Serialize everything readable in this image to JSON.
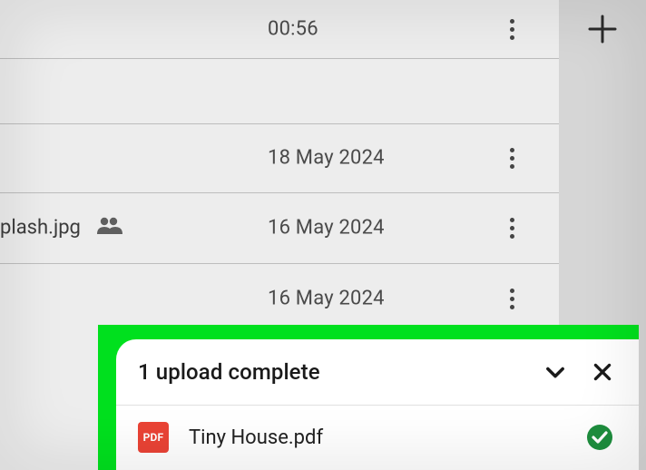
{
  "list": {
    "rows": [
      {
        "date": "00:56"
      },
      {
        "date": ""
      },
      {
        "date": "18 May 2024"
      },
      {
        "name": "plash.jpg",
        "date": "16 May 2024",
        "shared": true
      },
      {
        "date": "16 May 2024"
      }
    ]
  },
  "snackbar": {
    "title": "1 upload complete",
    "file": {
      "badge": "PDF",
      "name": "Tiny House.pdf"
    }
  }
}
